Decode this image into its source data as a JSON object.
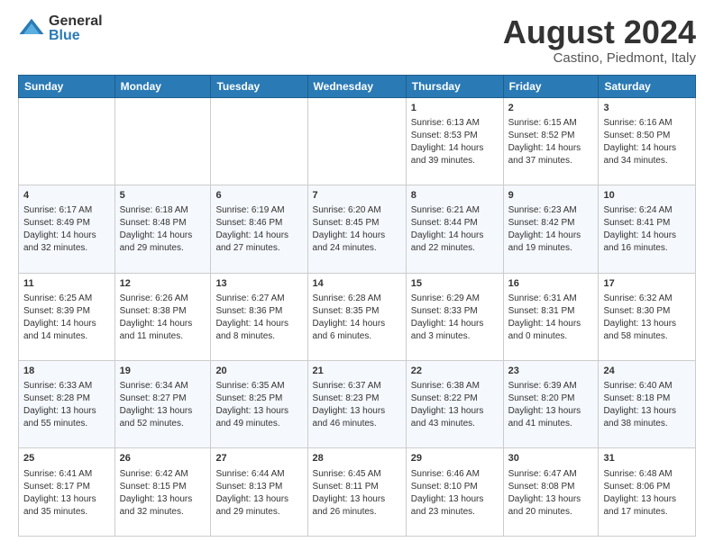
{
  "logo": {
    "general": "General",
    "blue": "Blue"
  },
  "header": {
    "month": "August 2024",
    "location": "Castino, Piedmont, Italy"
  },
  "weekdays": [
    "Sunday",
    "Monday",
    "Tuesday",
    "Wednesday",
    "Thursday",
    "Friday",
    "Saturday"
  ],
  "weeks": [
    [
      {
        "day": "",
        "sunrise": "",
        "sunset": "",
        "daylight": ""
      },
      {
        "day": "",
        "sunrise": "",
        "sunset": "",
        "daylight": ""
      },
      {
        "day": "",
        "sunrise": "",
        "sunset": "",
        "daylight": ""
      },
      {
        "day": "",
        "sunrise": "",
        "sunset": "",
        "daylight": ""
      },
      {
        "day": "1",
        "sunrise": "Sunrise: 6:13 AM",
        "sunset": "Sunset: 8:53 PM",
        "daylight": "Daylight: 14 hours and 39 minutes."
      },
      {
        "day": "2",
        "sunrise": "Sunrise: 6:15 AM",
        "sunset": "Sunset: 8:52 PM",
        "daylight": "Daylight: 14 hours and 37 minutes."
      },
      {
        "day": "3",
        "sunrise": "Sunrise: 6:16 AM",
        "sunset": "Sunset: 8:50 PM",
        "daylight": "Daylight: 14 hours and 34 minutes."
      }
    ],
    [
      {
        "day": "4",
        "sunrise": "Sunrise: 6:17 AM",
        "sunset": "Sunset: 8:49 PM",
        "daylight": "Daylight: 14 hours and 32 minutes."
      },
      {
        "day": "5",
        "sunrise": "Sunrise: 6:18 AM",
        "sunset": "Sunset: 8:48 PM",
        "daylight": "Daylight: 14 hours and 29 minutes."
      },
      {
        "day": "6",
        "sunrise": "Sunrise: 6:19 AM",
        "sunset": "Sunset: 8:46 PM",
        "daylight": "Daylight: 14 hours and 27 minutes."
      },
      {
        "day": "7",
        "sunrise": "Sunrise: 6:20 AM",
        "sunset": "Sunset: 8:45 PM",
        "daylight": "Daylight: 14 hours and 24 minutes."
      },
      {
        "day": "8",
        "sunrise": "Sunrise: 6:21 AM",
        "sunset": "Sunset: 8:44 PM",
        "daylight": "Daylight: 14 hours and 22 minutes."
      },
      {
        "day": "9",
        "sunrise": "Sunrise: 6:23 AM",
        "sunset": "Sunset: 8:42 PM",
        "daylight": "Daylight: 14 hours and 19 minutes."
      },
      {
        "day": "10",
        "sunrise": "Sunrise: 6:24 AM",
        "sunset": "Sunset: 8:41 PM",
        "daylight": "Daylight: 14 hours and 16 minutes."
      }
    ],
    [
      {
        "day": "11",
        "sunrise": "Sunrise: 6:25 AM",
        "sunset": "Sunset: 8:39 PM",
        "daylight": "Daylight: 14 hours and 14 minutes."
      },
      {
        "day": "12",
        "sunrise": "Sunrise: 6:26 AM",
        "sunset": "Sunset: 8:38 PM",
        "daylight": "Daylight: 14 hours and 11 minutes."
      },
      {
        "day": "13",
        "sunrise": "Sunrise: 6:27 AM",
        "sunset": "Sunset: 8:36 PM",
        "daylight": "Daylight: 14 hours and 8 minutes."
      },
      {
        "day": "14",
        "sunrise": "Sunrise: 6:28 AM",
        "sunset": "Sunset: 8:35 PM",
        "daylight": "Daylight: 14 hours and 6 minutes."
      },
      {
        "day": "15",
        "sunrise": "Sunrise: 6:29 AM",
        "sunset": "Sunset: 8:33 PM",
        "daylight": "Daylight: 14 hours and 3 minutes."
      },
      {
        "day": "16",
        "sunrise": "Sunrise: 6:31 AM",
        "sunset": "Sunset: 8:31 PM",
        "daylight": "Daylight: 14 hours and 0 minutes."
      },
      {
        "day": "17",
        "sunrise": "Sunrise: 6:32 AM",
        "sunset": "Sunset: 8:30 PM",
        "daylight": "Daylight: 13 hours and 58 minutes."
      }
    ],
    [
      {
        "day": "18",
        "sunrise": "Sunrise: 6:33 AM",
        "sunset": "Sunset: 8:28 PM",
        "daylight": "Daylight: 13 hours and 55 minutes."
      },
      {
        "day": "19",
        "sunrise": "Sunrise: 6:34 AM",
        "sunset": "Sunset: 8:27 PM",
        "daylight": "Daylight: 13 hours and 52 minutes."
      },
      {
        "day": "20",
        "sunrise": "Sunrise: 6:35 AM",
        "sunset": "Sunset: 8:25 PM",
        "daylight": "Daylight: 13 hours and 49 minutes."
      },
      {
        "day": "21",
        "sunrise": "Sunrise: 6:37 AM",
        "sunset": "Sunset: 8:23 PM",
        "daylight": "Daylight: 13 hours and 46 minutes."
      },
      {
        "day": "22",
        "sunrise": "Sunrise: 6:38 AM",
        "sunset": "Sunset: 8:22 PM",
        "daylight": "Daylight: 13 hours and 43 minutes."
      },
      {
        "day": "23",
        "sunrise": "Sunrise: 6:39 AM",
        "sunset": "Sunset: 8:20 PM",
        "daylight": "Daylight: 13 hours and 41 minutes."
      },
      {
        "day": "24",
        "sunrise": "Sunrise: 6:40 AM",
        "sunset": "Sunset: 8:18 PM",
        "daylight": "Daylight: 13 hours and 38 minutes."
      }
    ],
    [
      {
        "day": "25",
        "sunrise": "Sunrise: 6:41 AM",
        "sunset": "Sunset: 8:17 PM",
        "daylight": "Daylight: 13 hours and 35 minutes."
      },
      {
        "day": "26",
        "sunrise": "Sunrise: 6:42 AM",
        "sunset": "Sunset: 8:15 PM",
        "daylight": "Daylight: 13 hours and 32 minutes."
      },
      {
        "day": "27",
        "sunrise": "Sunrise: 6:44 AM",
        "sunset": "Sunset: 8:13 PM",
        "daylight": "Daylight: 13 hours and 29 minutes."
      },
      {
        "day": "28",
        "sunrise": "Sunrise: 6:45 AM",
        "sunset": "Sunset: 8:11 PM",
        "daylight": "Daylight: 13 hours and 26 minutes."
      },
      {
        "day": "29",
        "sunrise": "Sunrise: 6:46 AM",
        "sunset": "Sunset: 8:10 PM",
        "daylight": "Daylight: 13 hours and 23 minutes."
      },
      {
        "day": "30",
        "sunrise": "Sunrise: 6:47 AM",
        "sunset": "Sunset: 8:08 PM",
        "daylight": "Daylight: 13 hours and 20 minutes."
      },
      {
        "day": "31",
        "sunrise": "Sunrise: 6:48 AM",
        "sunset": "Sunset: 8:06 PM",
        "daylight": "Daylight: 13 hours and 17 minutes."
      }
    ]
  ]
}
